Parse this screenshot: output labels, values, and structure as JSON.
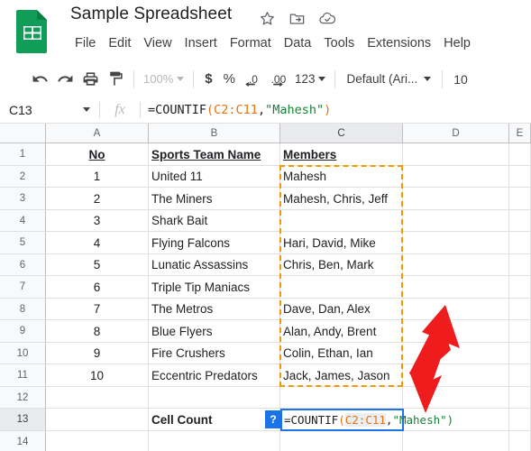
{
  "app": {
    "title": "Sample Spreadsheet",
    "logo_icon": "google-sheets-logo-icon",
    "accent_color": "#0f9d58",
    "title_icons": [
      {
        "name": "star-icon",
        "label": "Star"
      },
      {
        "name": "move-to-folder-icon",
        "label": "Move"
      },
      {
        "name": "cloud-saved-icon",
        "label": "Saved to Drive"
      }
    ]
  },
  "menubar": {
    "items": [
      {
        "label": "File"
      },
      {
        "label": "Edit"
      },
      {
        "label": "View"
      },
      {
        "label": "Insert"
      },
      {
        "label": "Format"
      },
      {
        "label": "Data"
      },
      {
        "label": "Tools"
      },
      {
        "label": "Extensions"
      },
      {
        "label": "Help"
      }
    ]
  },
  "toolbar": {
    "undo_icon": "undo-icon",
    "redo_icon": "redo-icon",
    "print_icon": "print-icon",
    "paint_format_icon": "paint-format-icon",
    "zoom_value": "100%",
    "currency_label": "$",
    "percent_label": "%",
    "decrease_decimal_label": ".0",
    "increase_decimal_label": ".00",
    "number_format_label": "123",
    "font_family_value": "Default (Ari...",
    "font_size_value": "10"
  },
  "formula_bar": {
    "name_box_value": "C13",
    "fx_label": "fx",
    "formula": {
      "prefix": "=COUNTIF",
      "open_paren": "(",
      "range": "C2:C11",
      "comma": ",",
      "criterion": "\"Mahesh\"",
      "close_paren": ")",
      "full_text": "=COUNTIF(C2:C11,\"Mahesh\")"
    }
  },
  "grid": {
    "columns": [
      {
        "label": "A",
        "selected": false
      },
      {
        "label": "B",
        "selected": false
      },
      {
        "label": "C",
        "selected": true
      },
      {
        "label": "D",
        "selected": false
      },
      {
        "label": "E",
        "selected": false
      }
    ],
    "rows": [
      {
        "num": "1",
        "selected": false,
        "a": "No",
        "b": "Sports Team Name",
        "c": "Members",
        "style": "header"
      },
      {
        "num": "2",
        "selected": false,
        "a": "1",
        "b": "United 11",
        "c": "Mahesh",
        "style": "normal"
      },
      {
        "num": "3",
        "selected": false,
        "a": "2",
        "b": "The Miners",
        "c": "Mahesh, Chris, Jeff",
        "style": "normal"
      },
      {
        "num": "4",
        "selected": false,
        "a": "3",
        "b": "Shark Bait",
        "c": "",
        "style": "normal"
      },
      {
        "num": "5",
        "selected": false,
        "a": "4",
        "b": "Flying Falcons",
        "c": "Hari, David, Mike",
        "style": "normal"
      },
      {
        "num": "6",
        "selected": false,
        "a": "5",
        "b": "Lunatic Assassins",
        "c": "Chris, Ben, Mark",
        "style": "normal"
      },
      {
        "num": "7",
        "selected": false,
        "a": "6",
        "b": "Triple Tip Maniacs",
        "c": "",
        "style": "normal"
      },
      {
        "num": "8",
        "selected": false,
        "a": "7",
        "b": "The Metros",
        "c": "Dave, Dan, Alex",
        "style": "normal"
      },
      {
        "num": "9",
        "selected": false,
        "a": "8",
        "b": "Blue Flyers",
        "c": "Alan, Andy, Brent",
        "style": "normal"
      },
      {
        "num": "10",
        "selected": false,
        "a": "9",
        "b": "Fire Crushers",
        "c": "Colin, Ethan, Ian",
        "style": "normal"
      },
      {
        "num": "11",
        "selected": false,
        "a": "10",
        "b": "Eccentric Predators",
        "c": "Jack, James, Jason",
        "style": "normal"
      },
      {
        "num": "12",
        "selected": false,
        "a": "",
        "b": "",
        "c": "",
        "style": "normal"
      },
      {
        "num": "13",
        "selected": true,
        "a": "",
        "b": "Cell Count",
        "c": "",
        "style": "label-bold"
      },
      {
        "num": "14",
        "selected": false,
        "a": "",
        "b": "",
        "c": "",
        "style": "normal"
      }
    ],
    "marching_ants_range": "C2:C11",
    "marching_ants_color": "#f29900"
  },
  "cell_editor": {
    "cell": "C13",
    "help_badge_label": "?",
    "border_color": "#1a73e8",
    "formula": {
      "prefix": "=COUNTIF",
      "open_paren": "(",
      "range": "C2:C11",
      "comma": ",",
      "criterion": "\"Mahesh\"",
      "close_paren": ")",
      "full_text": "=COUNTIF(C2:C11,\"Mahesh\")"
    }
  },
  "annotation": {
    "arrow_color": "#ee1c1c",
    "arrow_direction": "down-left",
    "points_to": "C13"
  }
}
